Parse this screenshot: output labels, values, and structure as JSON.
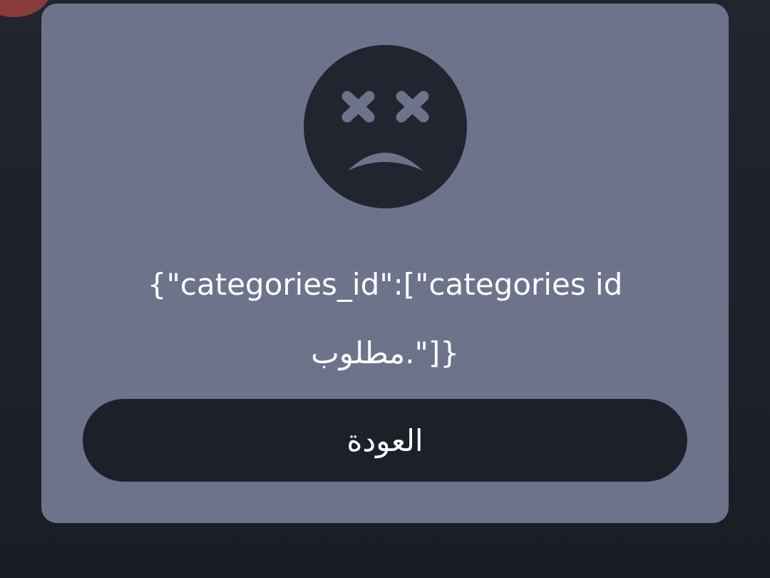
{
  "dialog": {
    "icon": "sad-face-x-eyes-icon",
    "message": "{\"categories_id\":[\"categories id مطلوب.\"]}",
    "back_button_label": "العودة"
  },
  "colors": {
    "background": "#1c1f27",
    "dialog_background": "#6e738c",
    "icon_fill": "#22252f",
    "button_background": "#1e2029",
    "text": "#ffffff",
    "corner_badge": "#8a3b3b"
  }
}
